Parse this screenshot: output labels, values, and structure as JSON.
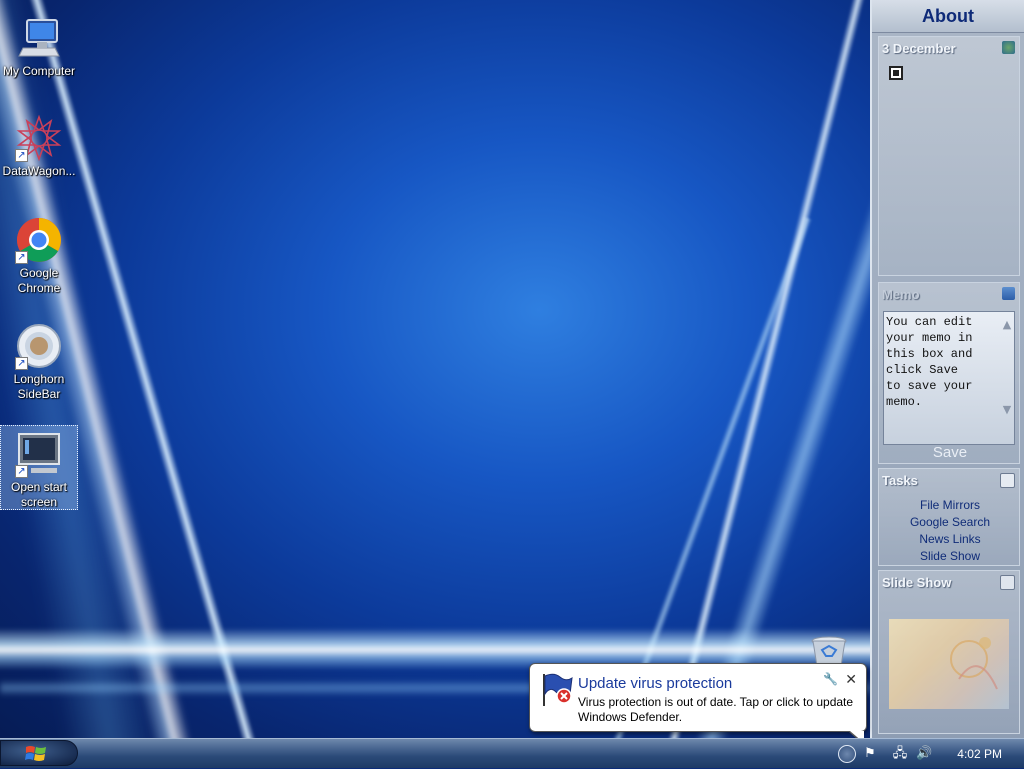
{
  "desktop_icons": [
    {
      "label": "My Computer",
      "icon": "computer-icon"
    },
    {
      "label": "DataWagon...",
      "icon": "datawagon-icon"
    },
    {
      "label": "Google Chrome",
      "icon": "chrome-icon"
    },
    {
      "label": "Longhorn SideBar",
      "icon": "longhorn-sidebar-icon"
    },
    {
      "label": "Open start screen",
      "icon": "monitor-icon"
    }
  ],
  "sidebar": {
    "title": "About",
    "calendar_title": "3 December",
    "memo": {
      "title": "Memo",
      "text": "You can edit\nyour memo in\nthis box and\nclick Save\nto save your\nmemo.",
      "save_label": "Save"
    },
    "tasks": {
      "title": "Tasks",
      "items": [
        "File Mirrors",
        "Google Search",
        "News Links",
        "Slide Show"
      ]
    },
    "slideshow_title": "Slide Show"
  },
  "notification": {
    "title": "Update virus protection",
    "message": "Virus protection is out of date. Tap or click to update Windows Defender."
  },
  "taskbar": {
    "clock": "4:02 PM"
  },
  "colors": {
    "sidebar_title": "#0e2a78",
    "task_link": "#102c78",
    "notification_title": "#1a3a9c"
  }
}
